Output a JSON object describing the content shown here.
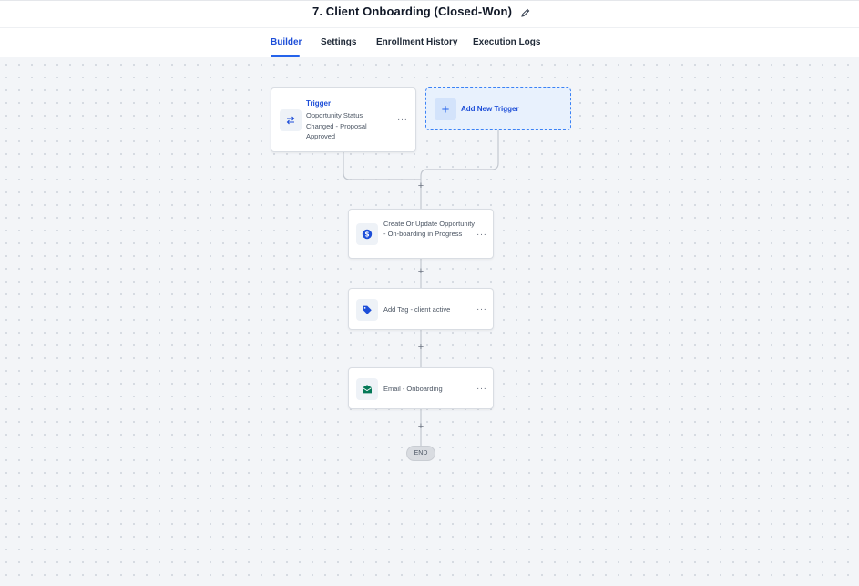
{
  "header": {
    "title": "7. Client Onboarding (Closed-Won)",
    "edit_icon": "pencil-icon"
  },
  "tabs": [
    {
      "label": "Builder",
      "active": true
    },
    {
      "label": "Settings",
      "active": false
    },
    {
      "label": "Enrollment History",
      "active": false
    },
    {
      "label": "Execution Logs",
      "active": false
    }
  ],
  "workflow": {
    "trigger": {
      "label": "Trigger",
      "description": "Opportunity Status Changed - Proposal Approved",
      "icon": "arrows-swap-icon",
      "menu": "···"
    },
    "add_trigger": {
      "label": "Add New Trigger",
      "icon": "plus-icon",
      "plus_glyph": "+"
    },
    "actions": [
      {
        "label": "Create Or Update Opportunity - On-boarding in Progress",
        "icon": "dollar-icon",
        "icon_color": "#1d4ed8",
        "menu": "···"
      },
      {
        "label": "Add Tag - client active",
        "icon": "tag-icon",
        "icon_color": "#1d4ed8",
        "menu": "···"
      },
      {
        "label": "Email - Onboarding",
        "icon": "envelope-icon",
        "icon_color": "#047857",
        "menu": "···"
      }
    ],
    "add_step_glyph": "+",
    "end_label": "END"
  },
  "colors": {
    "accent": "#2563eb",
    "connector": "#c3c8d0"
  }
}
